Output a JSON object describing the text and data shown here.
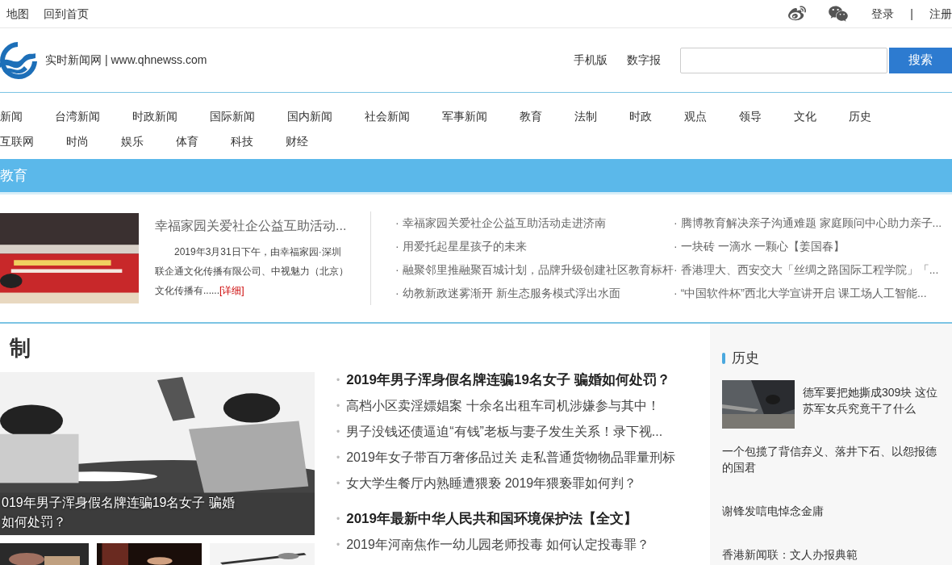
{
  "top_bar": {
    "left_links": [
      "地图",
      "回到首页"
    ],
    "right_links": [
      "登录",
      "注册"
    ],
    "separator": "|"
  },
  "header": {
    "site_name": "实时新闻网 | www.qhnewss.com",
    "links": [
      "手机版",
      "数字报"
    ],
    "search": {
      "button": "搜索"
    }
  },
  "nav": {
    "items": [
      "新闻",
      "台湾新闻",
      "时政新闻",
      "国际新闻",
      "国内新闻",
      "社会新闻",
      "军事新闻",
      "教育",
      "法制",
      "时政",
      "观点",
      "领导",
      "文化",
      "历史",
      "互联网",
      "时尚",
      "娱乐",
      "体育",
      "科技",
      "财经"
    ]
  },
  "education": {
    "title": "教育",
    "bullet": "·",
    "feature": {
      "headline": "幸福家园关爱社企公益互助活动...",
      "summary": "2019年3月31日下午，由幸福家园·深圳联企通文化传播有限公司、中视魅力（北京）文化传播有......",
      "more": "[详细]"
    },
    "news_columns": [
      [
        "幸福家园关爱社企公益互助活动走进济南",
        "用爱托起星星孩子的未来",
        "融聚邻里推融聚百城计划，品牌升级创建社区教育标杆",
        "幼教新政迷雾渐开 新生态服务模式浮出水面"
      ],
      [
        "腾博教育解决亲子沟通难题 家庭顾问中心助力亲子...",
        "一块砖 一滴水 一颗心【姜国春】",
        "香港理大、西安交大「丝绸之路国际工程学院」「...",
        "“中国软件杯”西北大学宣讲开启 课工场人工智能..."
      ]
    ]
  },
  "law": {
    "title": "制",
    "bullet": "•",
    "caption": "019年男子浑身假名牌连骗19名女子 骗婚如何处罚？",
    "groups": [
      [
        {
          "text": "2019年男子浑身假名牌连骗19名女子 骗婚如何处罚？",
          "bold": true
        },
        {
          "text": "高档小区卖淫嫖娼案 十余名出租车司机涉嫌参与其中！",
          "bold": false
        },
        {
          "text": "男子没钱还债逼迫“有钱”老板与妻子发生关系！录下视...",
          "bold": false
        },
        {
          "text": "2019年女子带百万奢侈品过关 走私普通货物物品罪量刑标",
          "bold": false
        },
        {
          "text": "女大学生餐厅内熟睡遭猥亵 2019年猥亵罪如何判？",
          "bold": false
        }
      ],
      [
        {
          "text": "2019年最新中华人民共和国环境保护法【全文】",
          "bold": true
        },
        {
          "text": "2019年河南焦作一幼儿园老师投毒 如何认定投毒罪？",
          "bold": false
        }
      ]
    ]
  },
  "history": {
    "title": "历史",
    "items": [
      {
        "kind": "thumb",
        "text": "德军要把她撕成309块 这位苏军女兵究竟干了什么"
      },
      {
        "kind": "text",
        "text": "一个包揽了背信弃义、落井下石、以怨报德的国君"
      },
      {
        "kind": "text",
        "text": "谢锋发唁电悼念金庸"
      },
      {
        "kind": "text",
        "text": "香港新闻联：文人办报典範"
      }
    ]
  }
}
